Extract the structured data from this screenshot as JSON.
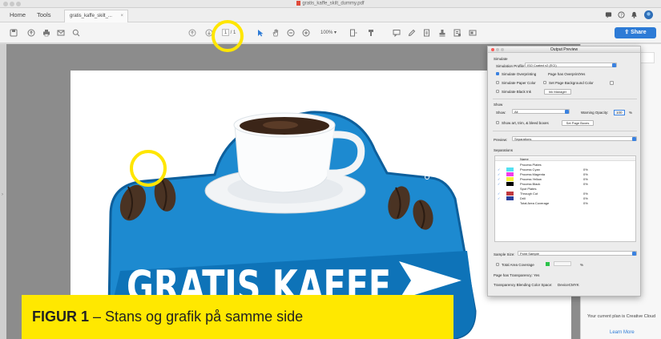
{
  "window": {
    "title": "gratis_kaffe_skilt_dummy.pdf"
  },
  "tabs": {
    "home": "Home",
    "tools": "Tools",
    "document": "gratis_kaffe_skilt_...",
    "close": "×"
  },
  "toolbar": {
    "page_current": "1",
    "page_total": "/ 1",
    "zoom": "100%",
    "share": "Share",
    "icons": [
      "save-icon",
      "upload-icon",
      "print-icon",
      "email-icon",
      "search-icon",
      "prev-page-icon",
      "next-page-icon",
      "select-arrow-icon",
      "hand-icon",
      "zoom-out-icon",
      "zoom-in-icon",
      "fit-page-icon",
      "highlight-icon",
      "comment-icon",
      "pen-icon",
      "fill-sign-icon",
      "stamp-icon",
      "sign-icon",
      "redact-icon"
    ]
  },
  "dialog": {
    "title": "Output Preview",
    "simulate_heading": "Simulate",
    "simulation_profile_label": "Simulation Profile:",
    "simulation_profile_value": "ISO Coated v2 (ECI)",
    "simulate_overprinting": "Simulate Overprinting",
    "page_has_overprint_label": "Page has Overprint:",
    "page_has_overprint_value": "Yes",
    "simulate_paper_color": "Simulate Paper Color",
    "set_page_bg_color": "Set Page Background Color",
    "simulate_black_ink": "Simulate Black Ink",
    "ink_manager": "Ink Manager",
    "show_heading": "Show",
    "show_label": "Show:",
    "show_value": "All",
    "warning_opacity_label": "Warning Opacity:",
    "warning_opacity_value": "100",
    "warning_opacity_unit": "%",
    "show_art_trim": "Show art, trim, & bleed boxes",
    "set_page_boxes": "Set Page Boxes",
    "preview_label": "Preview:",
    "preview_value": "Separations",
    "separations_heading": "Separations",
    "col_name": "Name",
    "plates": [
      {
        "name": "Process Plates",
        "pct": "",
        "color": "",
        "check": false
      },
      {
        "name": "Process Cyan",
        "pct": "0%",
        "color": "#52e1f2",
        "check": true
      },
      {
        "name": "Process Magenta",
        "pct": "0%",
        "color": "#f23ee9",
        "check": true
      },
      {
        "name": "Process Yellow",
        "pct": "0%",
        "color": "#f6f23a",
        "check": true
      },
      {
        "name": "Process Black",
        "pct": "0%",
        "color": "#000000",
        "check": true
      },
      {
        "name": "Spot Plates",
        "pct": "",
        "color": "",
        "check": false
      },
      {
        "name": "Through Cut",
        "pct": "0%",
        "color": "#c0393f",
        "check": true
      },
      {
        "name": "Drill",
        "pct": "0%",
        "color": "#2b3f9c",
        "check": true
      },
      {
        "name": "Total Area Coverage",
        "pct": "0%",
        "color": "",
        "check": false
      }
    ],
    "sample_size_label": "Sample Size:",
    "sample_size_value": "Point Sample",
    "total_area_coverage": "Total Area Coverage",
    "tac_value": "",
    "tac_unit": "%",
    "page_has_transparency_label": "Page has Transparency:",
    "page_has_transparency_value": "Yes",
    "blending_space_label": "Transparency Blending Color Space:",
    "blending_space_value": "DeviceCMYK"
  },
  "right_panel": {
    "plan_text": "Your current plan is Creative Cloud",
    "learn_more": "Learn More"
  },
  "artwork": {
    "headline": "GRATIS KAFFE",
    "colors": {
      "blue": "#1d8ad0",
      "dark_blue": "#0d5f9c",
      "bean": "#4a3323"
    }
  },
  "caption": {
    "bold": "FIGUR 1",
    "rest": " – Stans og grafik på samme side"
  },
  "colors": {
    "accent": "#2d7bd6",
    "highlight": "#ffe600",
    "caption_bg": "#ffe800"
  }
}
